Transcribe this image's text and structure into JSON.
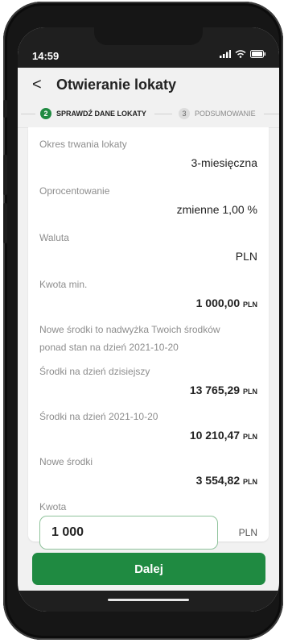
{
  "status_bar": {
    "time": "14:59"
  },
  "header": {
    "back_label": "<",
    "title": "Otwieranie lokaty"
  },
  "stepper": {
    "steps": [
      {
        "number": "2",
        "label": "SPRAWDŹ DANE LOKATY",
        "active": true
      },
      {
        "number": "3",
        "label": "PODSUMOWANIE",
        "active": false
      }
    ]
  },
  "details": [
    {
      "label": "Okres trwania lokaty",
      "value": "3-miesięczna"
    },
    {
      "label": "Oprocentowanie",
      "value": "zmienne 1,00 %"
    },
    {
      "label": "Waluta",
      "value": "PLN"
    },
    {
      "label": "Kwota min.",
      "value": "1 000,00",
      "currency": "PLN"
    },
    {
      "label": "Nowe środki to nadwyżka Twoich środków",
      "label_line2": "ponad stan na dzień 2021-10-20"
    },
    {
      "label": "Środki na dzień dzisiejszy",
      "value": "13 765,29",
      "currency": "PLN"
    },
    {
      "label": "Środki na dzień 2021-10-20",
      "value": "10 210,47",
      "currency": "PLN"
    },
    {
      "label": "Nowe środki",
      "value": "3 554,82",
      "currency": "PLN"
    }
  ],
  "amount": {
    "label": "Kwota",
    "value": "1 000",
    "currency": "PLN"
  },
  "actions": {
    "next_label": "Dalej"
  },
  "colors": {
    "accent": "#1f8a41",
    "input_border": "#8fc39b",
    "status_bar": "#1f1f1f"
  }
}
